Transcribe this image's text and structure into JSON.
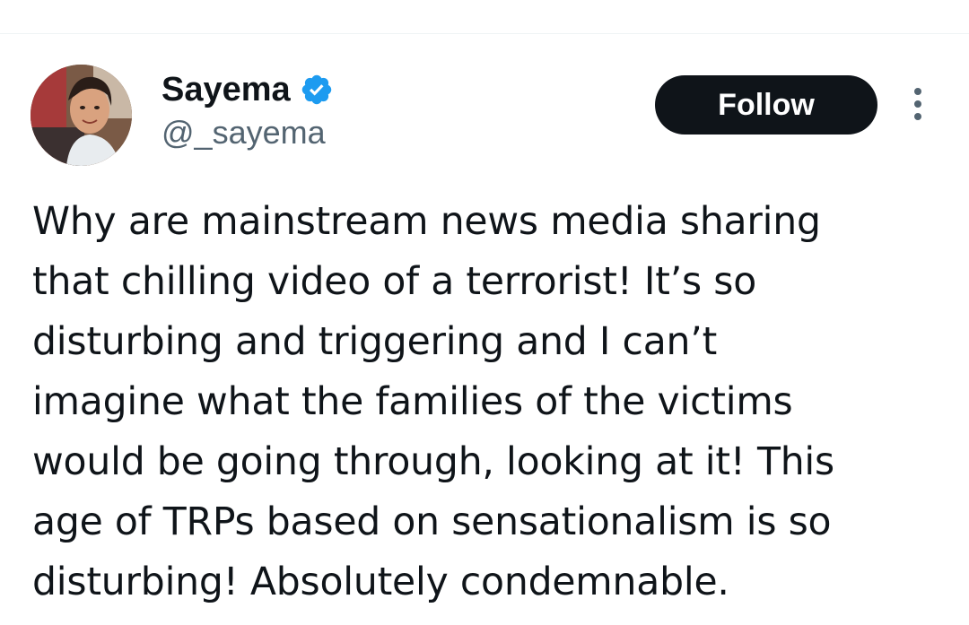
{
  "author": {
    "display_name": "Sayema",
    "handle": "@_sayema",
    "verified": true
  },
  "actions": {
    "follow_label": "Follow"
  },
  "tweet": {
    "lines": [
      "Why are mainstream news media sharing",
      "that chilling video of a terrorist! It’s so",
      "disturbing and triggering and I can’t",
      "imagine what the families of the victims",
      "would be going through, looking at it! This",
      "age of TRPs based on sensationalism is so",
      "disturbing! Absolutely condemnable."
    ]
  },
  "colors": {
    "text_primary": "#0f1419",
    "text_secondary": "#536471",
    "verified_blue": "#1d9bf0",
    "follow_bg": "#0f1419",
    "follow_text": "#ffffff"
  },
  "icons": {
    "verified": "verified-badge-icon",
    "more": "more-vertical-icon"
  }
}
